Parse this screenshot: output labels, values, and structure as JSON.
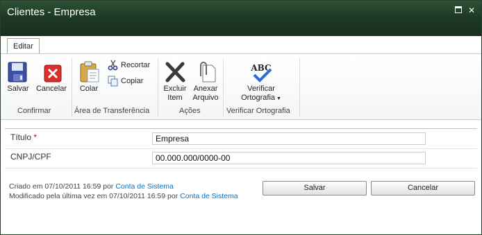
{
  "window": {
    "title": "Clientes - Empresa"
  },
  "tabs": [
    {
      "label": "Editar"
    }
  ],
  "ribbon": {
    "save": "Salvar",
    "cancel": "Cancelar",
    "paste": "Colar",
    "cut": "Recortar",
    "copy": "Copiar",
    "delete_line1": "Excluir",
    "delete_line2": "Item",
    "attach_line1": "Anexar",
    "attach_line2": "Arquivo",
    "spell_line1": "Verificar",
    "spell_line2": "Ortografia",
    "spell_icon_text": "ABC",
    "groups": {
      "confirm": "Confirmar",
      "clipboard": "Área de Transferência",
      "actions": "Ações",
      "spelling": "Verificar Ortografia"
    }
  },
  "form": {
    "title_label": "Título",
    "required_mark": "*",
    "title_value": "Empresa",
    "cnpj_label": "CNPJ/CPF",
    "cnpj_value": "00.000.000/0000-00"
  },
  "footer": {
    "created_prefix": "Criado em 07/10/2011 16:59 por",
    "created_by": "Conta de Sistema",
    "modified_prefix": "Modificado pela última vez em 07/10/2011 16:59 por",
    "modified_by": "Conta de Sistema",
    "save_button": "Salvar",
    "cancel_button": "Cancelar"
  }
}
